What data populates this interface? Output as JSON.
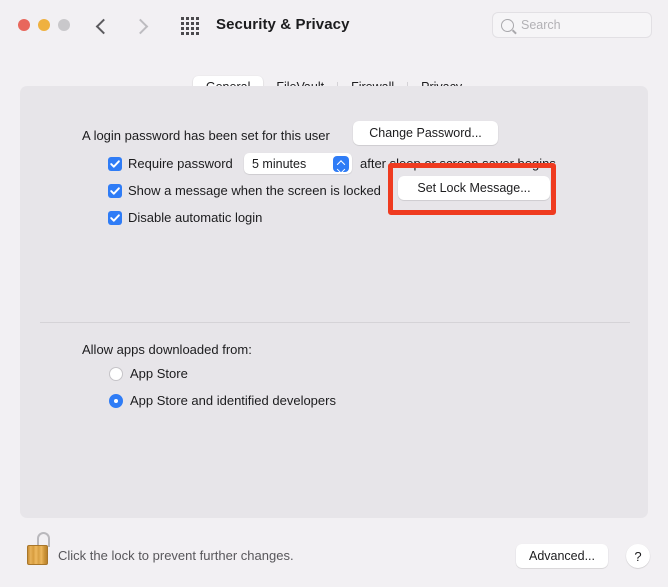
{
  "window": {
    "title": "Security & Privacy",
    "traffic_lights": [
      "close",
      "minimize",
      "zoom"
    ],
    "back_icon": "chevron-left-icon",
    "forward_icon": "chevron-right-icon",
    "grid_icon": "show-all-preferences-grid-icon"
  },
  "search": {
    "placeholder": "Search",
    "value": "",
    "icon": "search-icon"
  },
  "tabs": [
    {
      "label": "General",
      "selected": true
    },
    {
      "label": "FileVault",
      "selected": false
    },
    {
      "label": "Firewall",
      "selected": false
    },
    {
      "label": "Privacy",
      "selected": false
    }
  ],
  "general": {
    "password_status": "A login password has been set for this user",
    "change_password_label": "Change Password...",
    "require_password": {
      "checked": true,
      "label_before": "Require password",
      "delay_value": "5 minutes",
      "label_after": "after sleep or screen saver begins"
    },
    "show_message": {
      "checked": true,
      "label": "Show a message when the screen is locked",
      "button_label": "Set Lock Message..."
    },
    "disable_auto_login": {
      "checked": true,
      "label": "Disable automatic login"
    },
    "allow_apps": {
      "heading": "Allow apps downloaded from:",
      "options": [
        {
          "label": "App Store",
          "selected": false
        },
        {
          "label": "App Store and identified developers",
          "selected": true
        }
      ]
    }
  },
  "footer": {
    "lock_icon": "unlocked-padlock-icon",
    "lock_text": "Click the lock to prevent further changes.",
    "advanced_label": "Advanced...",
    "help_label": "?"
  },
  "annotation": {
    "color": "#ef3b20",
    "targets": "Set Lock Message... button"
  }
}
